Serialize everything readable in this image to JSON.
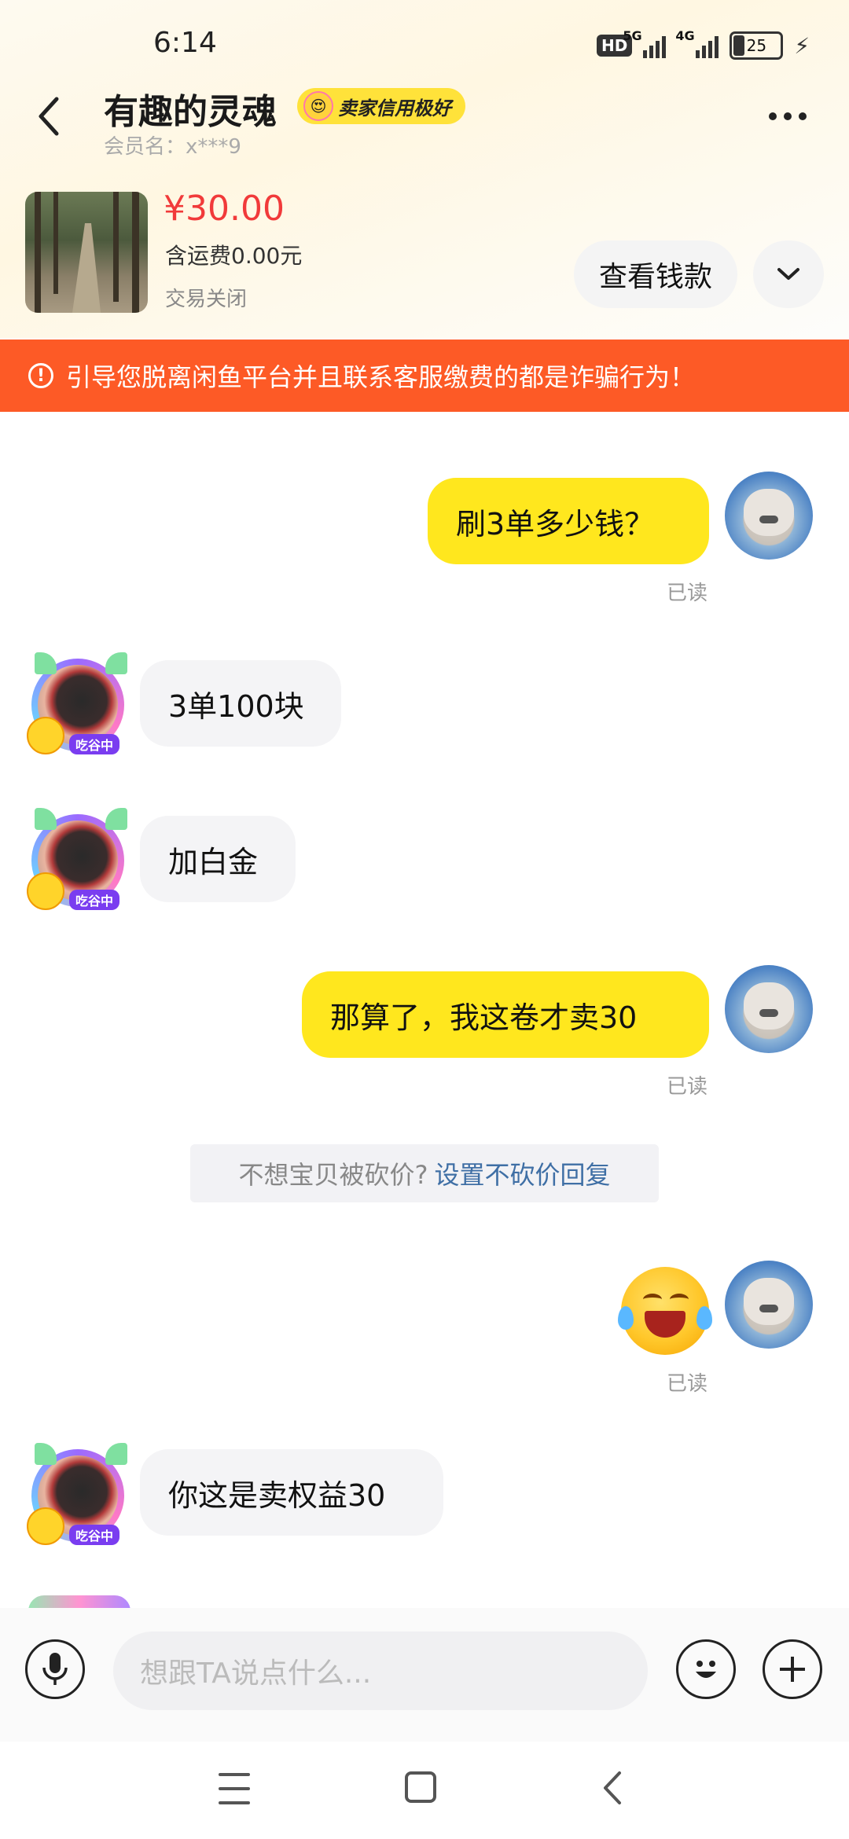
{
  "status_bar": {
    "time": "6:14",
    "hd_label": "HD",
    "net1": "5G",
    "net2": "4G",
    "battery": "25"
  },
  "header": {
    "title": "有趣的灵魂",
    "badge": "卖家信用极好",
    "member": "会员名：x***9"
  },
  "product": {
    "price": "¥30.00",
    "shipping": "含运费0.00元",
    "status": "交易关闭",
    "view_button": "查看钱款"
  },
  "warning": {
    "icon": "!",
    "text": "引导您脱离闲鱼平台并且联系客服缴费的都是诈骗行为！"
  },
  "messages": {
    "m1": {
      "text": "刷3单多少钱？",
      "read": "已读"
    },
    "m2": {
      "text": "3单100块"
    },
    "m3": {
      "text": "加白金"
    },
    "m4": {
      "text": "那算了，我这卷才卖30",
      "read": "已读"
    },
    "system": {
      "text": "不想宝贝被砍价?",
      "link": "设置不砍价回复"
    },
    "m5": {
      "read": "已读"
    },
    "m6": {
      "text": "你这是卖权益30"
    },
    "avatar_tag": "吃谷中"
  },
  "composer": {
    "placeholder": "想跟TA说点什么...",
    "plus": "+"
  },
  "colors": {
    "accent_yellow": "#ffe71e",
    "warning_orange": "#fd5a26",
    "price_red": "#f13a3a",
    "link_blue": "#3f6fa5"
  }
}
